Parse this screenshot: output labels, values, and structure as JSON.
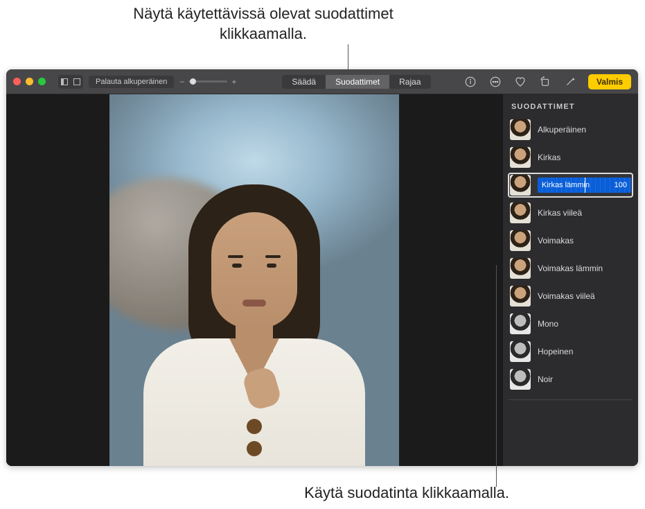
{
  "callouts": {
    "top": "Näytä käytettävissä olevat suodattimet klikkaamalla.",
    "bottom": "Käytä suodatinta klikkaamalla."
  },
  "toolbar": {
    "reset_label": "Palauta alkuperäinen",
    "zoom_minus": "−",
    "zoom_plus": "+",
    "tabs": {
      "adjust": "Säädä",
      "filters": "Suodattimet",
      "crop": "Rajaa"
    },
    "done_label": "Valmis"
  },
  "panel": {
    "title": "SUODATTIMET",
    "filters": [
      {
        "label": "Alkuperäinen",
        "mono": false,
        "selected": false
      },
      {
        "label": "Kirkas",
        "mono": false,
        "selected": false
      },
      {
        "label": "Kirkas lämmin",
        "mono": false,
        "selected": true,
        "value": "100"
      },
      {
        "label": "Kirkas viileä",
        "mono": false,
        "selected": false
      },
      {
        "label": "Voimakas",
        "mono": false,
        "selected": false
      },
      {
        "label": "Voimakas lämmin",
        "mono": false,
        "selected": false
      },
      {
        "label": "Voimakas viileä",
        "mono": false,
        "selected": false
      },
      {
        "label": "Mono",
        "mono": true,
        "selected": false
      },
      {
        "label": "Hopeinen",
        "mono": true,
        "selected": false
      },
      {
        "label": "Noir",
        "mono": true,
        "selected": false
      }
    ]
  }
}
